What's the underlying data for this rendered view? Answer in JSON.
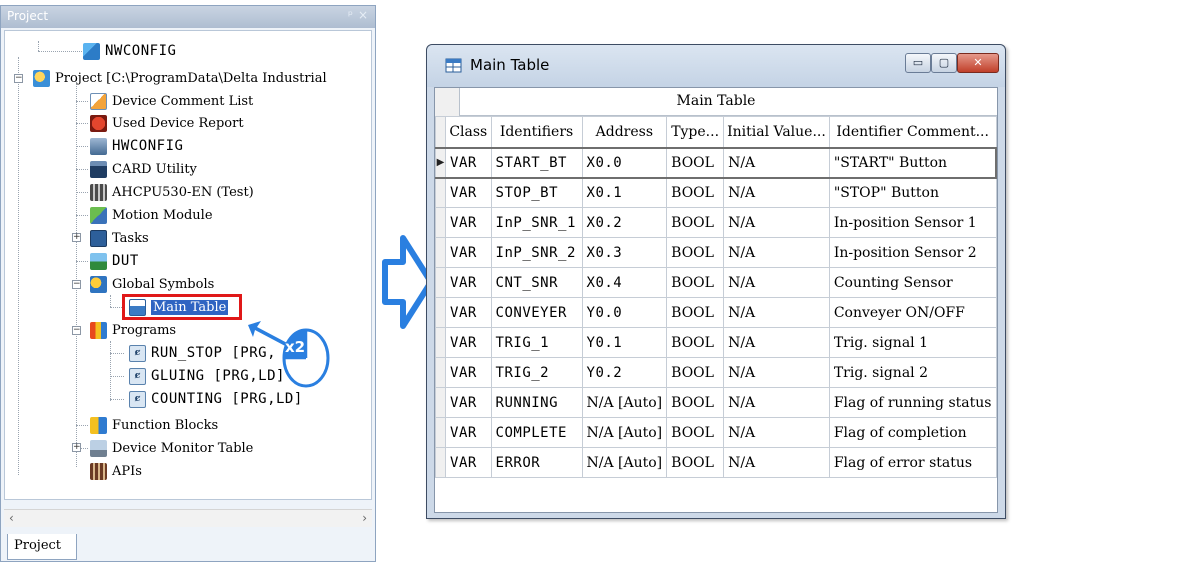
{
  "project_panel": {
    "title": "Project",
    "pin_glyph": "ᵖ",
    "close_glyph": "×",
    "tree": [
      {
        "label": "NWCONFIG",
        "icon": "network-config-icon"
      },
      {
        "label": "Project [C:\\ProgramData\\Delta Industrial",
        "icon": "project-icon"
      },
      {
        "label": "Device Comment List",
        "icon": "device-comment-list-icon"
      },
      {
        "label": "Used Device Report",
        "icon": "used-device-report-icon"
      },
      {
        "label": "HWCONFIG",
        "icon": "hardware-config-icon"
      },
      {
        "label": "CARD Utility",
        "icon": "card-utility-icon"
      },
      {
        "label": "AHCPU530-EN  (Test)",
        "icon": "cpu-icon"
      },
      {
        "label": "Motion Module",
        "icon": "motion-module-icon"
      },
      {
        "label": "Tasks",
        "icon": "tasks-icon"
      },
      {
        "label": "DUT",
        "icon": "dut-icon"
      },
      {
        "label": "Global Symbols",
        "icon": "global-symbols-icon"
      },
      {
        "label": "Main Table",
        "icon": "main-table-icon"
      },
      {
        "label": "Programs",
        "icon": "programs-icon"
      },
      {
        "label": "RUN_STOP [PRG,",
        "icon": "program-icon"
      },
      {
        "label": "GLUING [PRG,LD]",
        "icon": "program-icon"
      },
      {
        "label": "COUNTING [PRG,LD]",
        "icon": "program-icon"
      },
      {
        "label": "Function Blocks",
        "icon": "function-blocks-icon"
      },
      {
        "label": "Device Monitor Table",
        "icon": "device-monitor-table-icon"
      },
      {
        "label": "APIs",
        "icon": "apis-icon"
      }
    ],
    "expanders": {
      "project": "−",
      "tasks": "+",
      "global_symbols": "−",
      "programs": "−",
      "apis": "+"
    },
    "double_click_badge": "x2",
    "scroll_left": "‹",
    "scroll_right": "›",
    "tab_label": "Project"
  },
  "main_window": {
    "title": "Main Table",
    "min_glyph": "▭",
    "max_glyph": "▢",
    "close_glyph": "✕",
    "grid_caption": "Main Table",
    "selected_marker": "▶",
    "columns": [
      "Class",
      "Identifiers",
      "Address",
      "Type...",
      "Initial Value...",
      "Identifier Comment..."
    ],
    "rows": [
      [
        "VAR",
        "START_BT",
        "X0.0",
        "BOOL",
        "N/A",
        "\"START\" Button"
      ],
      [
        "VAR",
        "STOP_BT",
        "X0.1",
        "BOOL",
        "N/A",
        "\"STOP\" Button"
      ],
      [
        "VAR",
        "InP_SNR_1",
        "X0.2",
        "BOOL",
        "N/A",
        "In-position Sensor 1"
      ],
      [
        "VAR",
        "InP_SNR_2",
        "X0.3",
        "BOOL",
        "N/A",
        "In-position Sensor 2"
      ],
      [
        "VAR",
        "CNT_SNR",
        "X0.4",
        "BOOL",
        "N/A",
        "Counting Sensor"
      ],
      [
        "VAR",
        "CONVEYER",
        "Y0.0",
        "BOOL",
        "N/A",
        "Conveyer ON/OFF"
      ],
      [
        "VAR",
        "TRIG_1",
        "Y0.1",
        "BOOL",
        "N/A",
        "Trig. signal 1"
      ],
      [
        "VAR",
        "TRIG_2",
        "Y0.2",
        "BOOL",
        "N/A",
        "Trig. signal 2"
      ],
      [
        "VAR",
        "RUNNING",
        "N/A [Auto]",
        "BOOL",
        "N/A",
        "Flag of running status"
      ],
      [
        "VAR",
        "COMPLETE",
        "N/A [Auto]",
        "BOOL",
        "N/A",
        "Flag of completion"
      ],
      [
        "VAR",
        "ERROR",
        "N/A [Auto]",
        "BOOL",
        "N/A",
        "Flag of error status"
      ]
    ]
  },
  "colors": {
    "highlight": "#e01818",
    "selection": "#2f64c2",
    "arrow": "#2a7fe0"
  }
}
